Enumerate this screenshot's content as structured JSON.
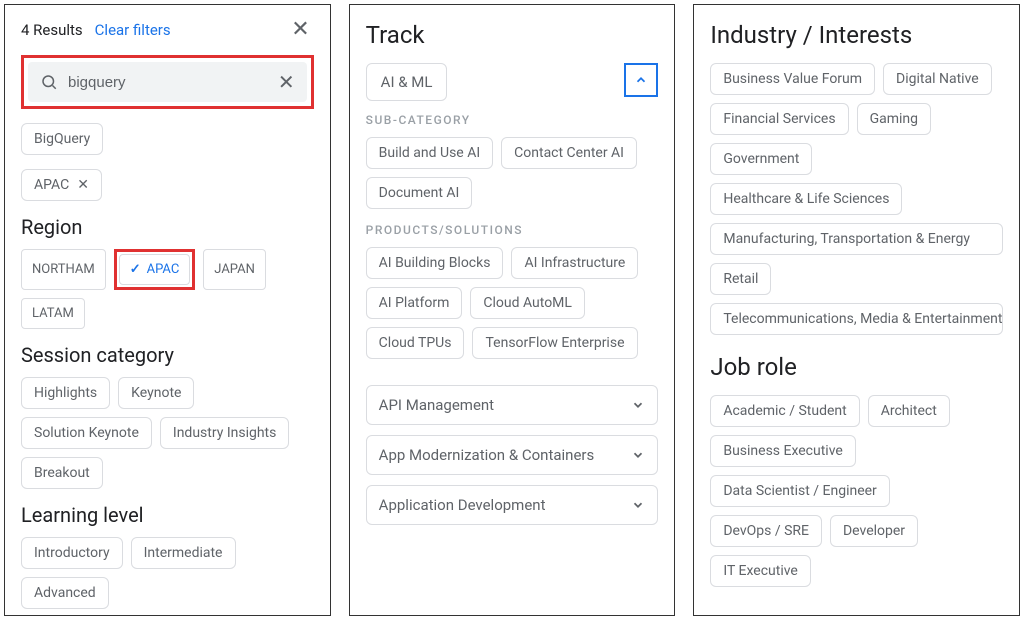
{
  "panel1": {
    "results_text": "4 Results",
    "clear_filters": "Clear filters",
    "search_value": "bigquery",
    "applied_filters": [
      {
        "label": "BigQuery",
        "removable": false
      },
      {
        "label": "APAC",
        "removable": true
      }
    ],
    "region": {
      "title": "Region",
      "options": [
        {
          "label": "NORTHAM",
          "selected": false
        },
        {
          "label": "APAC",
          "selected": true
        },
        {
          "label": "JAPAN",
          "selected": false
        },
        {
          "label": "LATAM",
          "selected": false
        }
      ]
    },
    "session_category": {
      "title": "Session category",
      "options": [
        "Highlights",
        "Keynote",
        "Solution Keynote",
        "Industry Insights",
        "Breakout"
      ]
    },
    "learning_level": {
      "title": "Learning level",
      "options": [
        "Introductory",
        "Intermediate",
        "Advanced"
      ]
    },
    "highlights": {
      "search": true,
      "region_apac": true
    }
  },
  "panel2": {
    "title": "Track",
    "open_item": "AI & ML",
    "sub_category": {
      "label": "SUB-CATEGORY",
      "options": [
        "Build and Use AI",
        "Contact Center AI",
        "Document AI"
      ]
    },
    "products_solutions": {
      "label": "PRODUCTS/SOLUTIONS",
      "options": [
        "AI Building Blocks",
        "AI Infrastructure",
        "AI Platform",
        "Cloud AutoML",
        "Cloud TPUs",
        "TensorFlow Enterprise"
      ]
    },
    "collapsed_tracks": [
      "API Management",
      "App Modernization & Containers",
      "Application Development"
    ]
  },
  "panel3": {
    "industry": {
      "title": "Industry / Interests",
      "options": [
        "Business Value Forum",
        "Digital Native",
        "Financial Services",
        "Gaming",
        "Government",
        "Healthcare & Life Sciences",
        "Manufacturing, Transportation & Energy",
        "Retail",
        "Telecommunications, Media & Entertainment"
      ]
    },
    "job_role": {
      "title": "Job role",
      "options": [
        "Academic / Student",
        "Architect",
        "Business Executive",
        "Data Scientist / Engineer",
        "DevOps / SRE",
        "Developer",
        "IT Executive"
      ]
    }
  }
}
